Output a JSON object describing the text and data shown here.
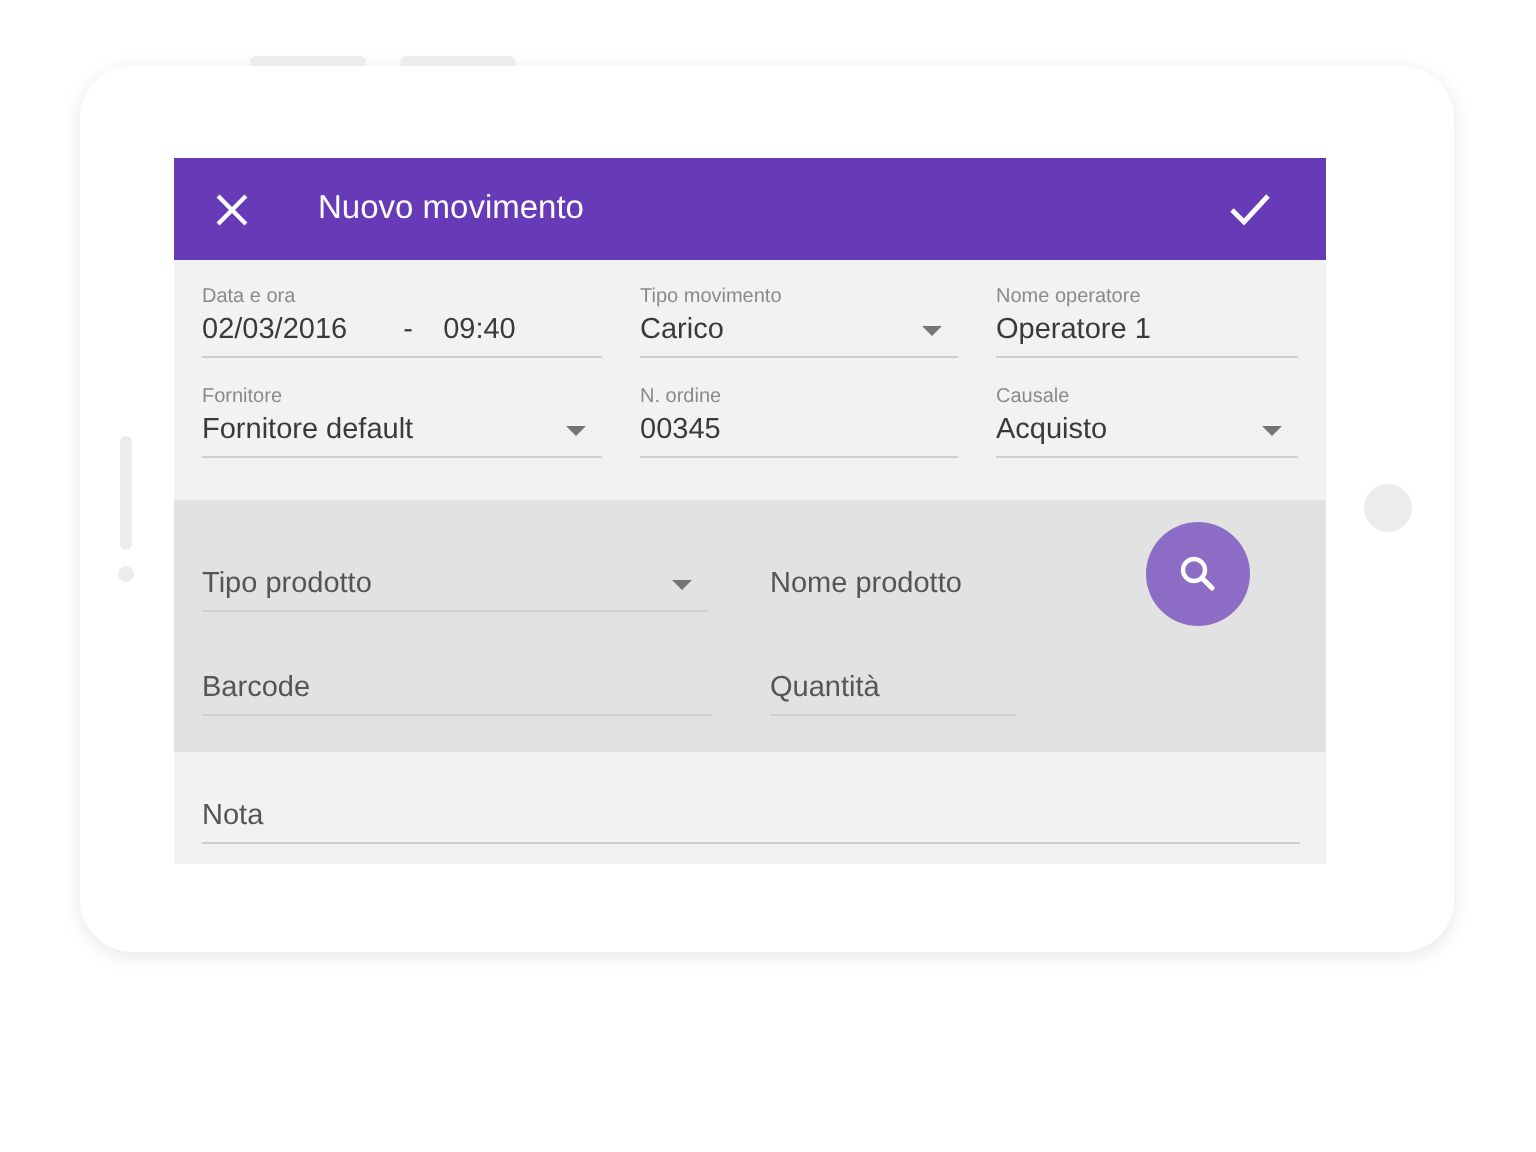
{
  "header": {
    "title": "Nuovo movimento"
  },
  "details": [
    {
      "kind": "datetime",
      "label": "Data e ora",
      "date": "02/03/2016",
      "separator": "-",
      "time": "09:40"
    },
    {
      "kind": "dropdown",
      "label": "Tipo movimento",
      "value": "Carico"
    },
    {
      "kind": "text",
      "label": "Nome operatore",
      "value": "Operatore 1"
    },
    {
      "kind": "dropdown",
      "label": "Fornitore",
      "value": "Fornitore default"
    },
    {
      "kind": "text",
      "label": "N. ordine",
      "value": "00345"
    },
    {
      "kind": "dropdown",
      "label": "Causale",
      "value": "Acquisto"
    }
  ],
  "product": [
    {
      "kind": "dropdown",
      "placeholder": "Tipo prodotto"
    },
    {
      "kind": "search",
      "placeholder": "Nome prodotto"
    },
    {
      "kind": "text",
      "placeholder": "Barcode"
    },
    {
      "kind": "text",
      "placeholder": "Quantità"
    }
  ],
  "note": {
    "placeholder": "Nota"
  }
}
